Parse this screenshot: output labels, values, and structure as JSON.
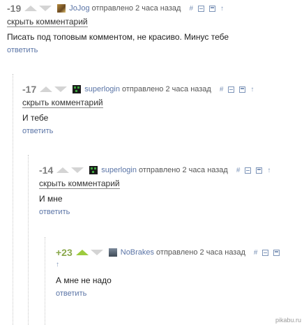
{
  "comments": [
    {
      "rating": "-19",
      "username": "JoJog",
      "posted": "отправлено",
      "time": "2 часа назад",
      "icon_hash": "#",
      "icon_arrow": "↑",
      "hide_label": "скрыть комментарий",
      "text": "Писать под топовым комментом, не красиво. Минус тебе",
      "reply_label": "ответить"
    },
    {
      "rating": "-17",
      "username": "superlogin",
      "posted": "отправлено",
      "time": "2 часа назад",
      "icon_hash": "#",
      "icon_arrow": "↑",
      "hide_label": "скрыть комментарий",
      "text": "И тебе",
      "reply_label": "ответить"
    },
    {
      "rating": "-14",
      "username": "superlogin",
      "posted": "отправлено",
      "time": "2 часа назад",
      "icon_hash": "#",
      "icon_arrow": "↑",
      "hide_label": "скрыть комментарий",
      "text": "И мне",
      "reply_label": "ответить"
    },
    {
      "rating": "+23",
      "username": "NoBrakes",
      "posted": "отправлено",
      "time": "2 часа назад",
      "icon_hash": "#",
      "icon_arrow": "↑",
      "text": "А мне не надо",
      "reply_label": "ответить"
    }
  ],
  "watermark": "pikabu.ru",
  "colors": {
    "link": "#5a74a6",
    "upvote_active": "#9dcb3e",
    "rating_positive": "#8aa84b",
    "rating_negative": "#7d7d7d"
  }
}
